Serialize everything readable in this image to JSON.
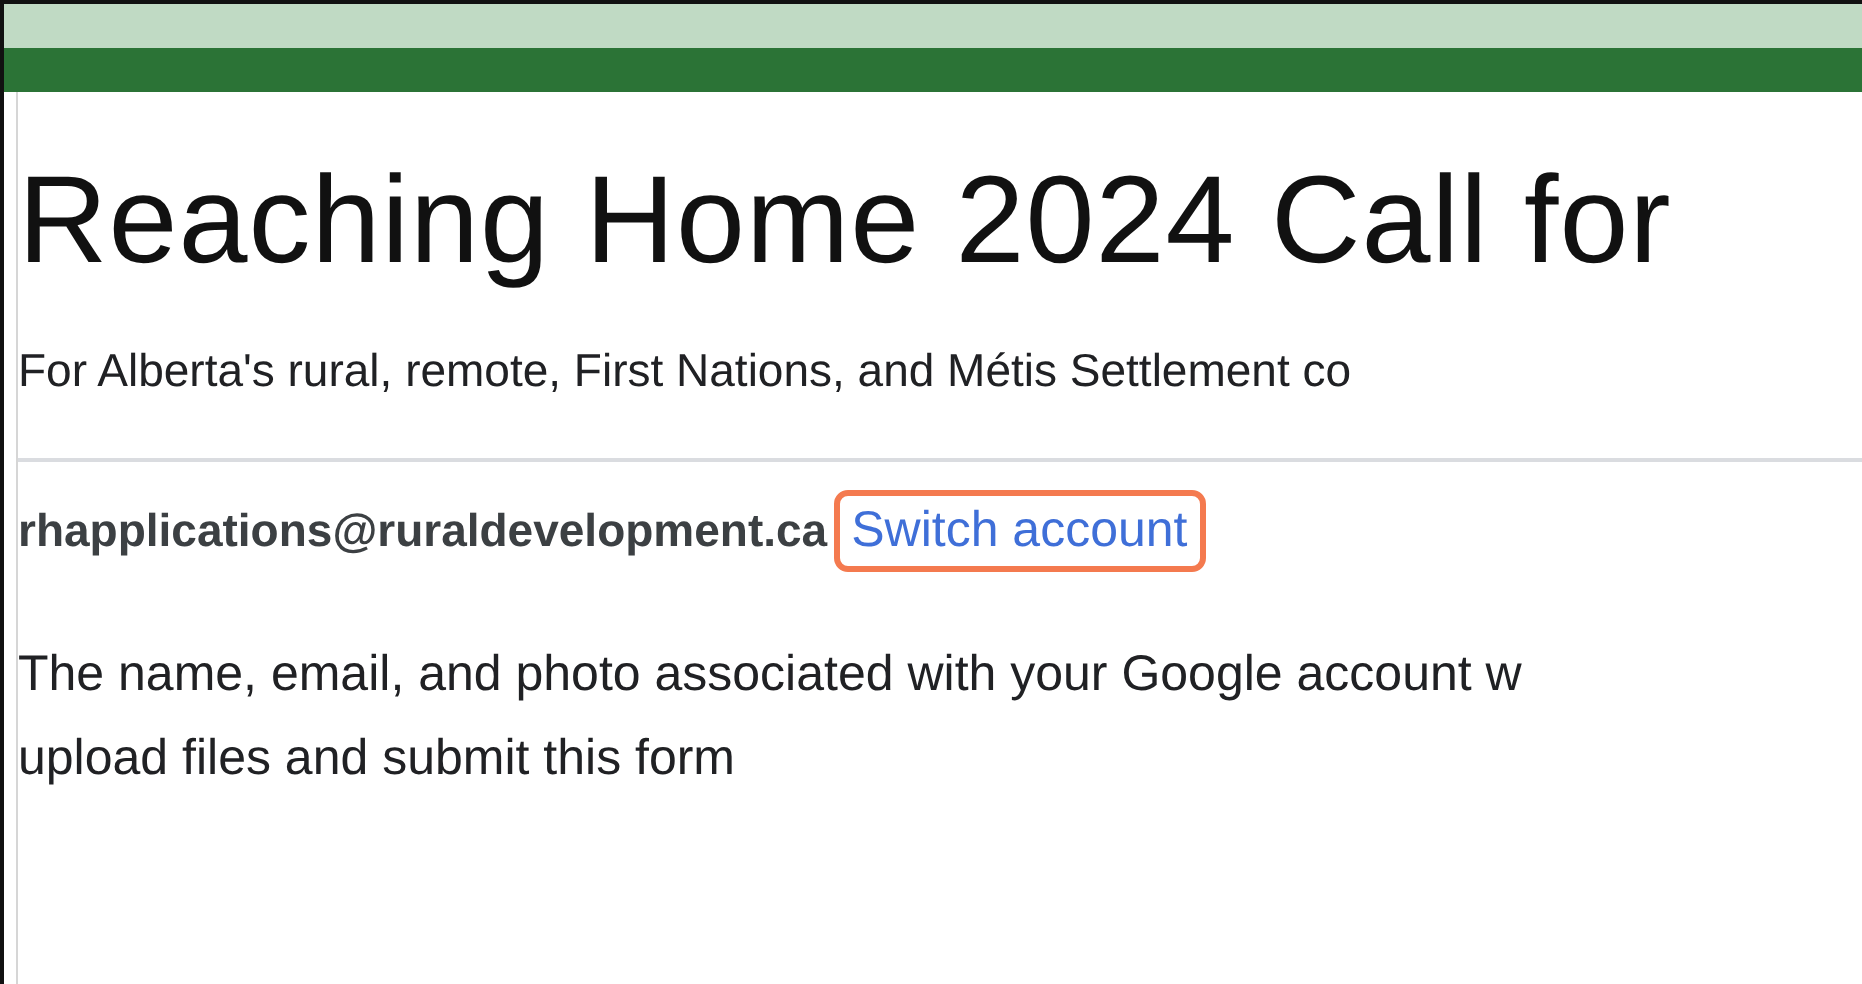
{
  "form": {
    "title": "Reaching Home 2024 Call for",
    "description": "For Alberta's rural, remote, First Nations, and Métis Settlement co",
    "account": {
      "email": "rhapplications@ruraldevelopment.ca",
      "switch_link": {
        "label": "Switch account",
        "highlighted": true
      }
    },
    "notice_lines": [
      "The name, email, and photo associated with your Google account w",
      "upload files and submit this form"
    ]
  }
}
